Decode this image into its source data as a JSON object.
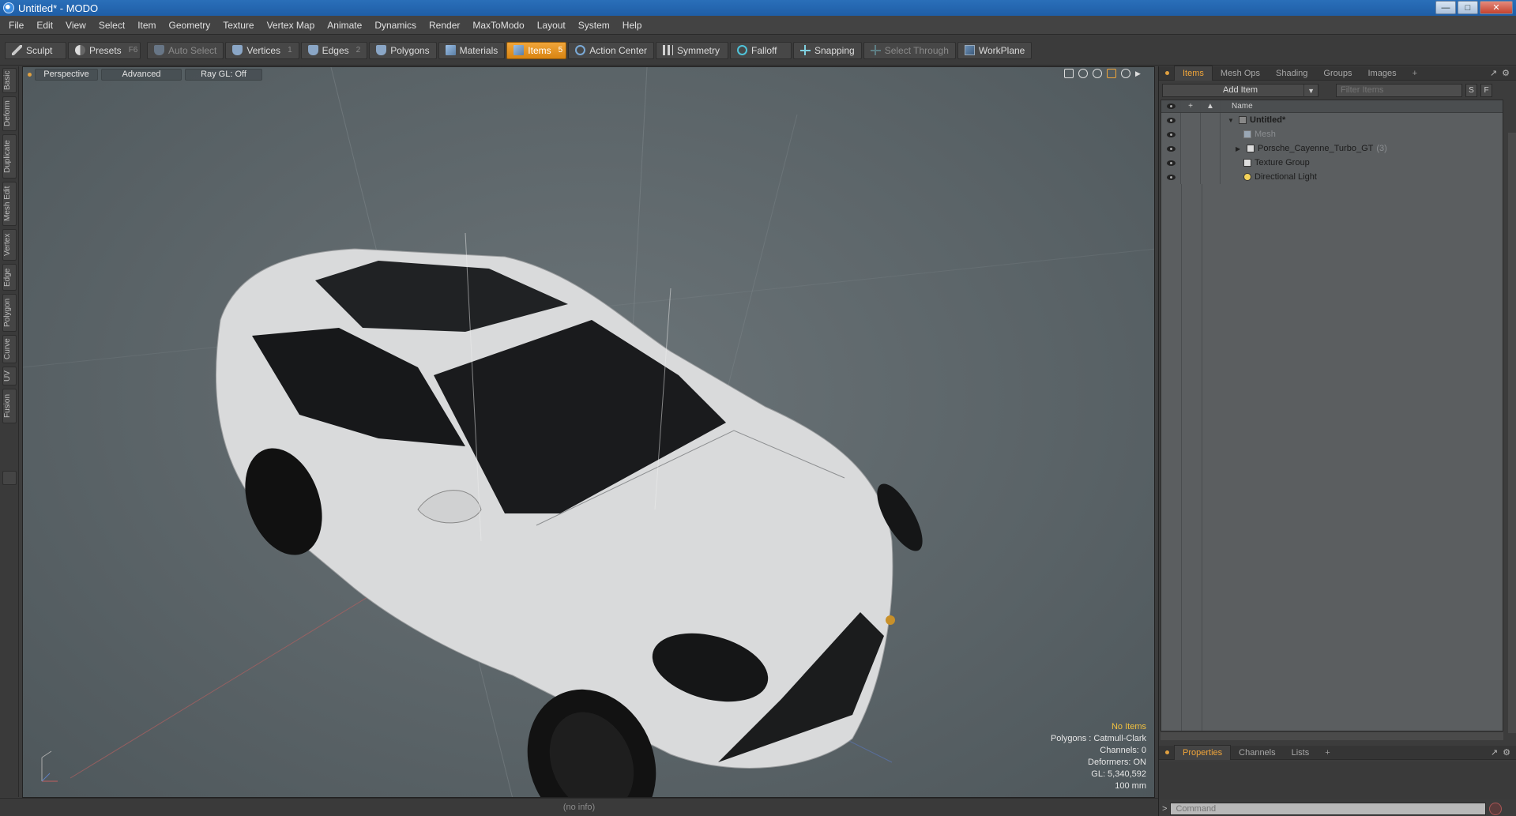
{
  "window": {
    "title": "Untitled* - MODO"
  },
  "menu": [
    "File",
    "Edit",
    "View",
    "Select",
    "Item",
    "Geometry",
    "Texture",
    "Vertex Map",
    "Animate",
    "Dynamics",
    "Render",
    "MaxToModo",
    "Layout",
    "System",
    "Help"
  ],
  "toolbar": {
    "sculpt": "Sculpt",
    "presets": "Presets",
    "presets_key": "F6",
    "auto_select": "Auto Select",
    "vertices": "Vertices",
    "vertices_key": "1",
    "edges": "Edges",
    "edges_key": "2",
    "polygons": "Polygons",
    "materials": "Materials",
    "items": "Items",
    "items_key": "5",
    "action_center": "Action Center",
    "symmetry": "Symmetry",
    "falloff": "Falloff",
    "snapping": "Snapping",
    "select_through": "Select Through",
    "workplane": "WorkPlane"
  },
  "left_tabs": [
    "Basic",
    "Deform",
    "Duplicate",
    "Mesh Edit",
    "Vertex",
    "Edge",
    "Polygon",
    "Curve",
    "UV",
    "Fusion"
  ],
  "viewport": {
    "view": "Perspective",
    "shading": "Advanced",
    "raygl": "Ray GL: Off",
    "info": {
      "selection": "No Items",
      "polygons": "Polygons : Catmull-Clark",
      "channels": "Channels: 0",
      "deformers": "Deformers: ON",
      "gl": "GL: 5,340,592",
      "scale": "100 mm"
    }
  },
  "status": "(no info)",
  "panel": {
    "tabs": [
      "Items",
      "Mesh Ops",
      "Shading",
      "Groups",
      "Images"
    ],
    "add_item": "Add Item",
    "filter_placeholder": "Filter Items",
    "btn_s": "S",
    "btn_f": "F",
    "col_name": "Name",
    "tree": [
      {
        "label": "Untitled*",
        "type": "scene"
      },
      {
        "label": "Mesh",
        "type": "mesh-dim"
      },
      {
        "label": "Porsche_Cayenne_Turbo_GT",
        "count": "(3)",
        "type": "group"
      },
      {
        "label": "Texture Group",
        "type": "group"
      },
      {
        "label": "Directional Light",
        "type": "light"
      }
    ]
  },
  "props": {
    "tabs": [
      "Properties",
      "Channels",
      "Lists"
    ]
  },
  "command": {
    "prompt": ">",
    "placeholder": "Command"
  },
  "colors": {
    "accent": "#f0a53a",
    "title_blue": "#1f5ea6",
    "viewport_bg": "#5a6367"
  }
}
